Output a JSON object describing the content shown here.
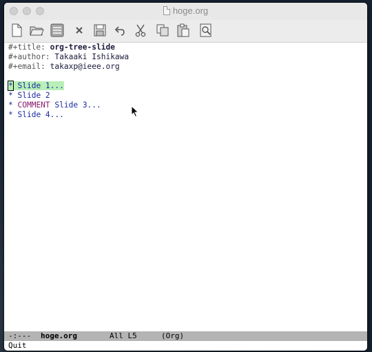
{
  "window": {
    "title": "hoge.org"
  },
  "toolbar": {
    "buttons": [
      {
        "name": "new-file",
        "icon": "new-file-icon"
      },
      {
        "name": "open-folder",
        "icon": "folder-icon"
      },
      {
        "name": "dired",
        "icon": "dired-icon"
      },
      {
        "name": "close-buffer",
        "icon": "close-icon"
      },
      {
        "name": "save",
        "icon": "save-icon"
      },
      {
        "name": "undo",
        "icon": "undo-icon"
      },
      {
        "name": "cut",
        "icon": "scissors-icon"
      },
      {
        "name": "copy",
        "icon": "copy-icon"
      },
      {
        "name": "paste",
        "icon": "paste-icon"
      },
      {
        "name": "search",
        "icon": "search-icon"
      }
    ]
  },
  "buffer": {
    "title_key": "#+title:",
    "title_value": "org-tree-slide",
    "author_key": "#+author:",
    "author_value": "Takaaki Ishikawa",
    "email_key": "#+email:",
    "email_value": "takaxp@ieee.org",
    "headings": [
      {
        "star": "*",
        "text": "Slide 1..."
      },
      {
        "star": "*",
        "text": "Slide 2"
      },
      {
        "star": "*",
        "comment": "COMMENT",
        "text": "Slide 3..."
      },
      {
        "star": "*",
        "text": "Slide 4..."
      }
    ]
  },
  "modeline": {
    "status": "-:---",
    "buffer_name": "hoge.org",
    "position": "All L5",
    "mode": "(Org)"
  },
  "echo_area": {
    "message": "Quit"
  },
  "colors": {
    "heading": "#1a2aa0",
    "comment_keyword": "#8b1a6b",
    "highlight": "#b8f0b8",
    "modeline_bg": "#b4b4b4"
  }
}
